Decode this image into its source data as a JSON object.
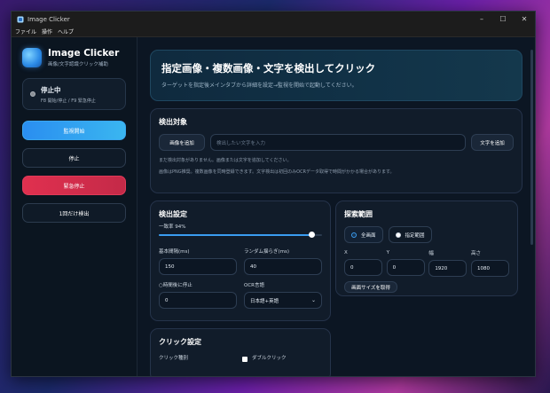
{
  "window": {
    "title": "Image Clicker",
    "controls": {
      "minimize": "–",
      "maximize": "☐",
      "close": "✕"
    }
  },
  "menu": [
    "ファイル",
    "操作",
    "ヘルプ"
  ],
  "sidebar": {
    "app_name": "Image Clicker",
    "app_sub": "画像/文字認識クリック補助",
    "status_title": "停止中",
    "status_sub": "F8 開始/停止 / F9 緊急停止",
    "buttons": {
      "start": "監視開始",
      "stop": "停止",
      "emergency": "緊急停止",
      "once": "1回だけ検出"
    }
  },
  "hero": {
    "title": "指定画像・複数画像・文字を検出してクリック",
    "subtitle": "ターゲットを指定後メインタブから詳細を設定→監視を開始で起動してください。"
  },
  "detect_target": {
    "title": "検出対象",
    "add_image": "画像を追加",
    "text_placeholder": "検出したい文字を入力",
    "add_text": "文字を追加",
    "note1": "まだ検出対象がありません。画像または文字を追加してください。",
    "note2": "画像はPNG推奨。複数画像を同時登録できます。文字検出は初回のみOCRデータ取得で時間がかかる場合があります。"
  },
  "detect_settings": {
    "title": "検出設定",
    "match_label": "一致率 94%",
    "match_value": 0.94,
    "interval_label": "基本間隔(ms)",
    "interval_value": "150",
    "jitter_label": "ランダム揺らぎ(ms)",
    "jitter_value": "40",
    "stop_after_label": "○時間後に停止",
    "stop_after_value": "0",
    "ocr_label": "OCR言語",
    "ocr_value": "日本語+英語"
  },
  "search_range": {
    "title": "探索範囲",
    "full_screen": "全画面",
    "specified": "指定範囲",
    "x_label": "X",
    "x_value": "0",
    "y_label": "Y",
    "y_value": "0",
    "w_label": "幅",
    "w_value": "1920",
    "h_label": "高さ",
    "h_value": "1080",
    "get_screen_size": "画面サイズを取得"
  },
  "click_settings": {
    "title": "クリック設定",
    "type_label": "クリック種別",
    "double_click": "ダブルクリック"
  },
  "colors": {
    "accent": "#3a9cf0",
    "danger": "#e0304f",
    "background": "#0c1623"
  }
}
